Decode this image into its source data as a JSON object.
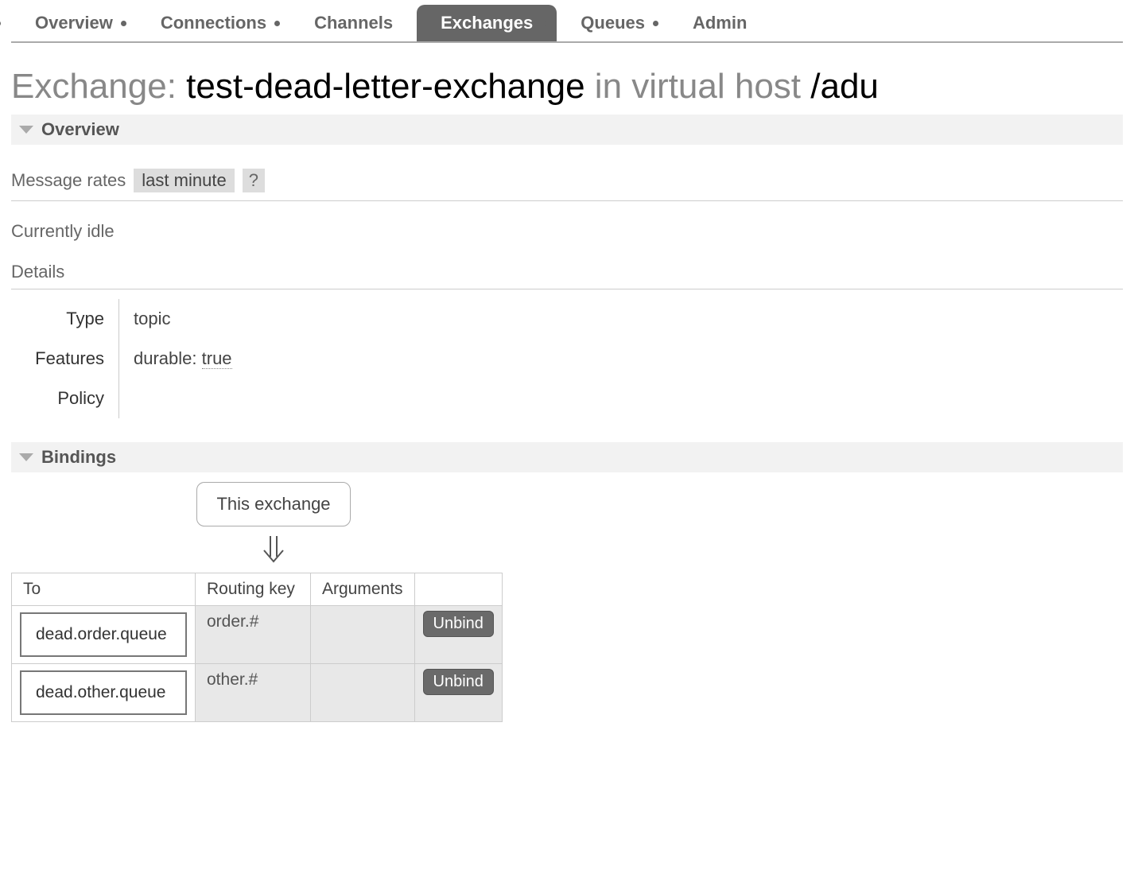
{
  "nav": {
    "items": [
      {
        "label": "Overview"
      },
      {
        "label": "Connections"
      },
      {
        "label": "Channels"
      },
      {
        "label": "Exchanges"
      },
      {
        "label": "Queues"
      },
      {
        "label": "Admin"
      }
    ]
  },
  "title": {
    "prefix": "Exchange: ",
    "name": "test-dead-letter-exchange",
    "mid": " in virtual host ",
    "vhost": "/adu"
  },
  "sections": {
    "overview": "Overview",
    "bindings": "Bindings"
  },
  "rates": {
    "label": "Message rates",
    "select": "last minute",
    "help": "?"
  },
  "idle": "Currently idle",
  "details": {
    "header": "Details",
    "rows": {
      "type_label": "Type",
      "type_value": "topic",
      "features_label": "Features",
      "features_key": "durable: ",
      "features_value": "true",
      "policy_label": "Policy",
      "policy_value": ""
    }
  },
  "bindings": {
    "this_exchange": "This exchange",
    "headers": {
      "to": "To",
      "routing_key": "Routing key",
      "arguments": "Arguments"
    },
    "rows": [
      {
        "to": "dead.order.queue",
        "routing_key": "order.#",
        "arguments": "",
        "action": "Unbind"
      },
      {
        "to": "dead.other.queue",
        "routing_key": "other.#",
        "arguments": "",
        "action": "Unbind"
      }
    ]
  }
}
